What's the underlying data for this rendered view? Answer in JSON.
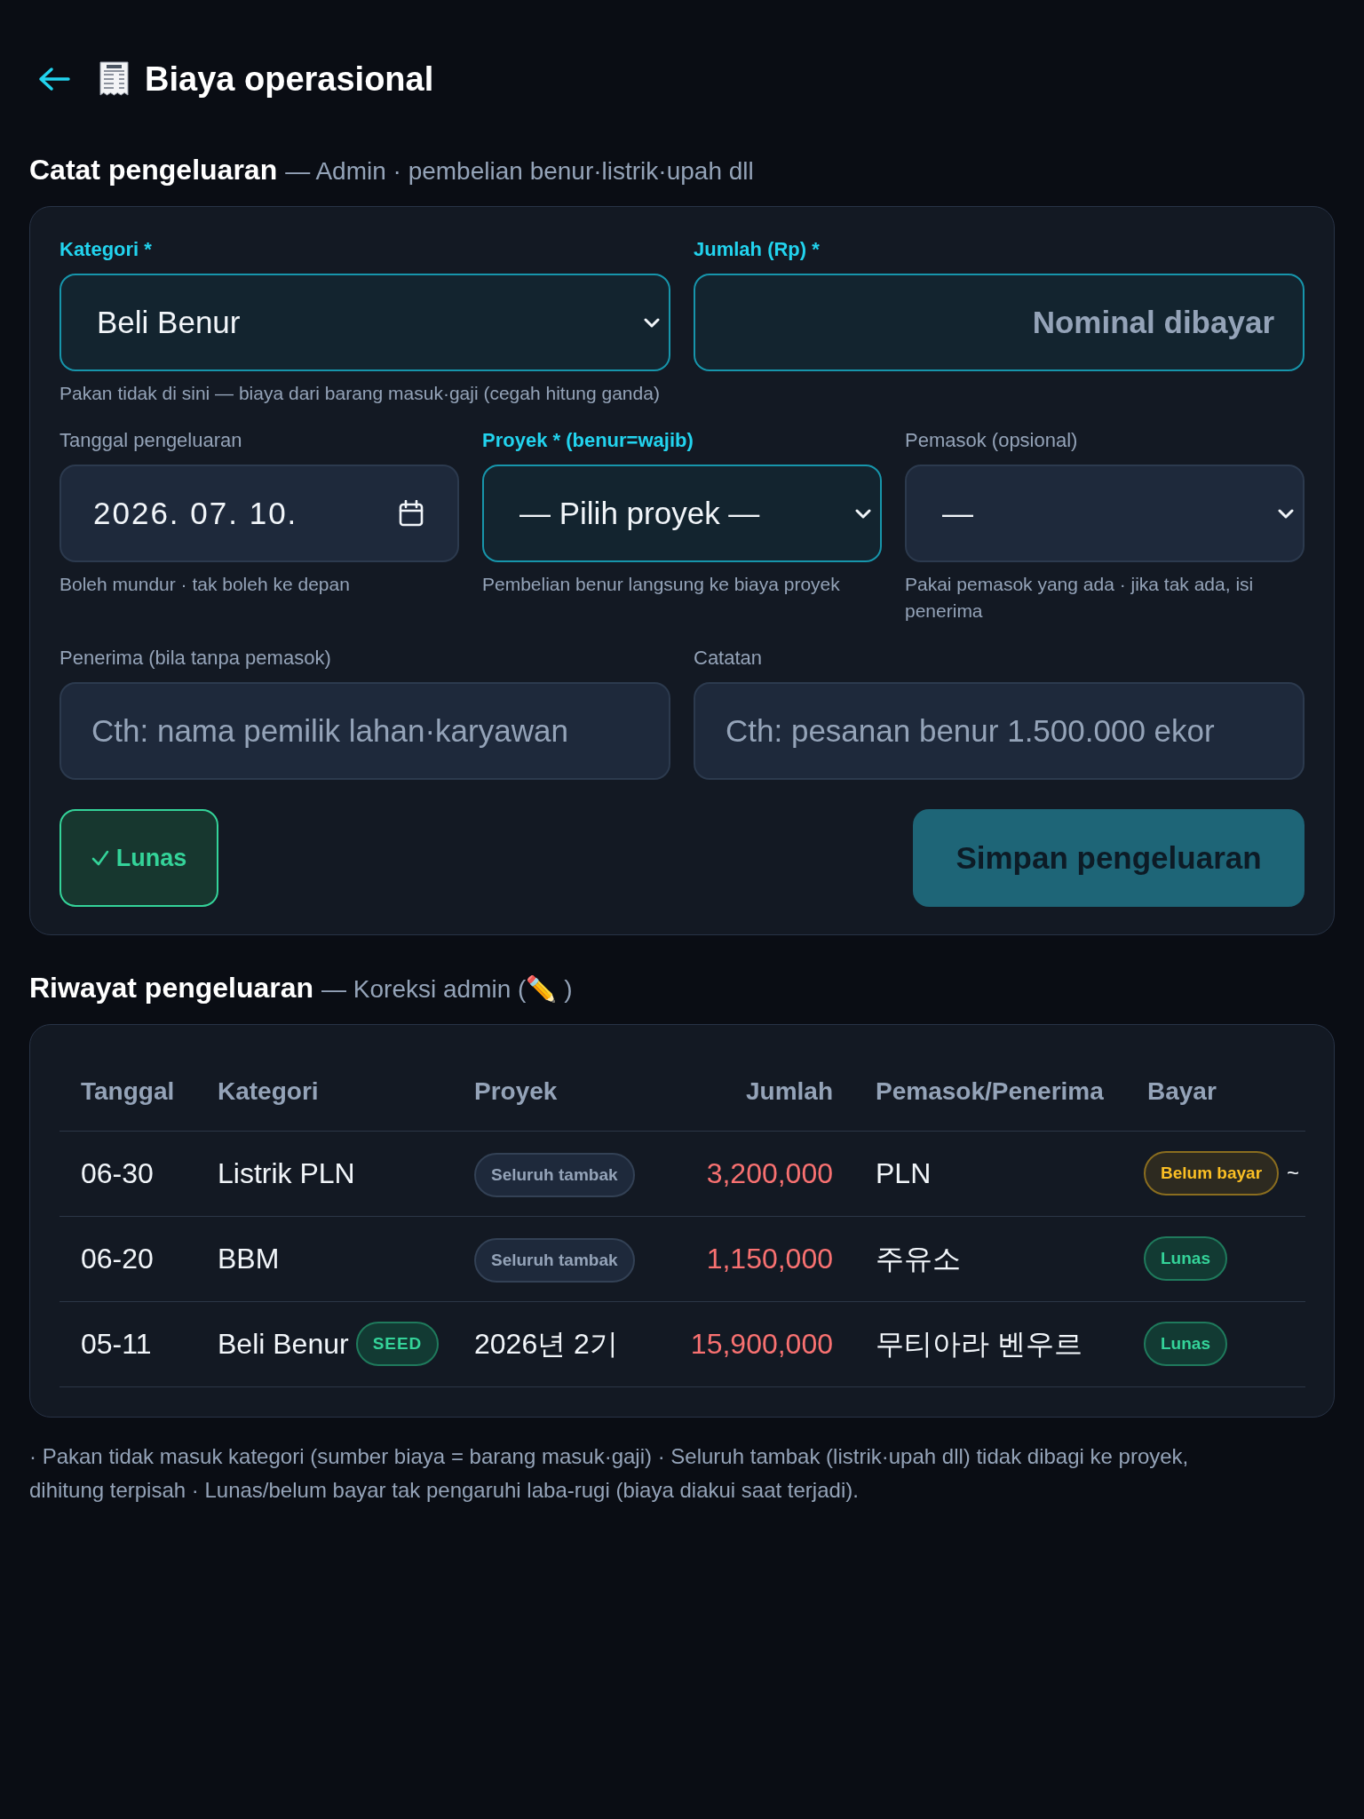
{
  "header": {
    "title": "Biaya operasional"
  },
  "form_section": {
    "title": "Catat pengeluaran",
    "subtitle": "— Admin · pembelian benur·listrik·upah dll"
  },
  "form": {
    "rows": [
      [
        {
          "kind": "select",
          "label": "Kategori *",
          "required": true,
          "value": "Beli Benur",
          "hint": "Pakan tidak di sini — biaya dari barang masuk·gaji (cegah hitung ganda)"
        },
        {
          "kind": "number",
          "label": "Jumlah (Rp) *",
          "required": true,
          "placeholder": "Nominal dibayar"
        }
      ],
      [
        {
          "kind": "date",
          "label": "Tanggal pengeluaran",
          "required": false,
          "value": "2026. 07. 10.",
          "hint": "Boleh mundur · tak boleh ke depan"
        },
        {
          "kind": "select",
          "label": "Proyek * (benur=wajib)",
          "required": true,
          "value": "— Pilih proyek —",
          "hint": "Pembelian benur langsung ke biaya proyek"
        },
        {
          "kind": "select",
          "label": "Pemasok (opsional)",
          "required": false,
          "value": "—",
          "hint": "Pakai pemasok yang ada · jika tak ada, isi penerima"
        }
      ],
      [
        {
          "kind": "text",
          "label": "Penerima (bila tanpa pemasok)",
          "required": false,
          "placeholder": "Cth: nama pemilik lahan·karyawan"
        },
        {
          "kind": "text",
          "label": "Catatan",
          "required": false,
          "placeholder": "Cth: pesanan benur 1.500.000 ekor"
        }
      ]
    ],
    "paid_toggle": {
      "label": "Lunas",
      "on": true
    },
    "submit": {
      "label": "Simpan pengeluaran"
    }
  },
  "history_section": {
    "title": "Riwayat pengeluaran",
    "subtitle": "— Koreksi admin (✏️ )"
  },
  "table": {
    "columns": [
      {
        "label": "Tanggal",
        "numeric": false
      },
      {
        "label": "Kategori",
        "numeric": false
      },
      {
        "label": "Proyek",
        "numeric": false
      },
      {
        "label": "Jumlah",
        "numeric": true
      },
      {
        "label": "Pemasok/Penerima",
        "numeric": false
      },
      {
        "label": "Bayar",
        "numeric": false
      }
    ],
    "rows": [
      {
        "date": "06-30",
        "category": "Listrik PLN",
        "project": {
          "kind": "badge",
          "text": "Seluruh tambak"
        },
        "amount": "3,200,000",
        "payee": "PLN",
        "payment": {
          "label": "Belum bayar",
          "paid": false
        },
        "column_7": "~"
      },
      {
        "date": "06-20",
        "category": "BBM",
        "project": {
          "kind": "badge",
          "text": "Seluruh tambak"
        },
        "amount": "1,150,000",
        "payee": "주유소",
        "payment": {
          "label": "Lunas",
          "paid": true
        }
      },
      {
        "date": "05-11",
        "category": "Beli Benur",
        "category_tag": "SEED",
        "project": {
          "kind": "text",
          "text": "2026년 2기"
        },
        "amount": "15,900,000",
        "payee": "무티아라 벤우르",
        "payment": {
          "label": "Lunas",
          "paid": true
        }
      }
    ]
  },
  "footer_note": "· Pakan tidak masuk kategori (sumber biaya = barang masuk·gaji) · Seluruh tambak (listrik·upah dll) tidak dibagi ke proyek, dihitung terpisah · Lunas/belum bayar tak pengaruhi laba-rugi (biaya diakui saat terjadi)."
}
